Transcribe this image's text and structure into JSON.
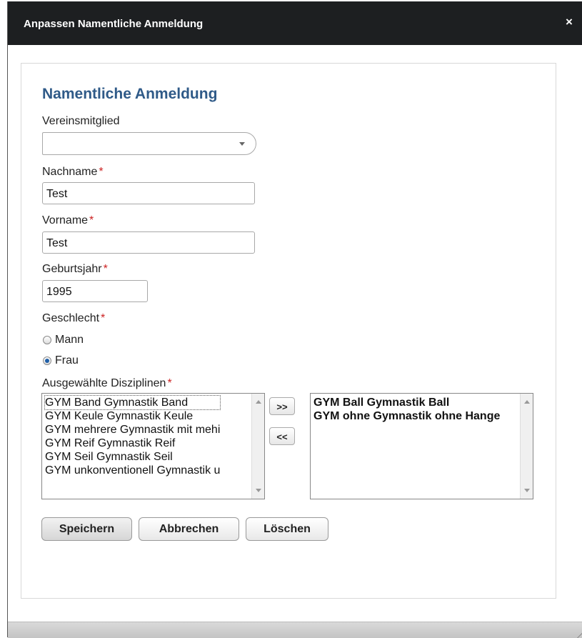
{
  "dialog": {
    "title": "Anpassen Namentliche Anmeldung",
    "close_symbol": "×"
  },
  "form": {
    "heading": "Namentliche Anmeldung",
    "required_marker": "*",
    "vereinsmitglied": {
      "label": "Vereinsmitglied",
      "value": ""
    },
    "nachname": {
      "label": "Nachname",
      "value": "Test"
    },
    "vorname": {
      "label": "Vorname",
      "value": "Test"
    },
    "geburtsjahr": {
      "label": "Geburtsjahr",
      "value": "1995"
    },
    "geschlecht": {
      "label": "Geschlecht",
      "options": [
        {
          "label": "Mann",
          "checked": false
        },
        {
          "label": "Frau",
          "checked": true
        }
      ]
    },
    "disziplinen": {
      "label": "Ausgewählte Disziplinen",
      "available": [
        "GYM Band Gymnastik Band",
        "GYM Keule Gymnastik Keule",
        "GYM mehrere Gymnastik mit mehi",
        "GYM Reif Gymnastik Reif",
        "GYM Seil Gymnastik Seil",
        "GYM unkonventionell Gymnastik u"
      ],
      "selected": [
        "GYM Ball Gymnastik Ball",
        "GYM ohne Gymnastik ohne Hange"
      ],
      "add_label": ">>",
      "remove_label": "<<"
    }
  },
  "buttons": {
    "save": "Speichern",
    "cancel": "Abbrechen",
    "delete": "Löschen"
  }
}
